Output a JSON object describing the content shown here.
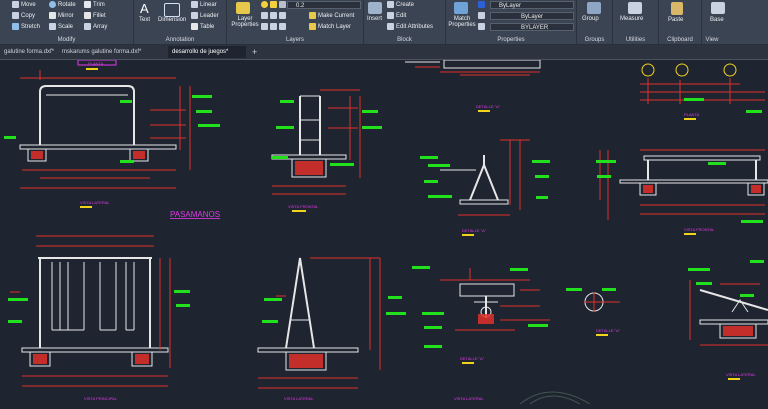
{
  "ribbon": {
    "modify": {
      "label": "Modify",
      "move": "Move",
      "rotate": "Rotate",
      "trim": "Trim",
      "copy": "Copy",
      "mirror": "Mirror",
      "fillet": "Fillet",
      "stretch": "Stretch",
      "scale": "Scale",
      "array": "Array"
    },
    "annotation": {
      "label": "Annotation",
      "text": "Text",
      "dimension": "Dimension",
      "linear": "Linear",
      "leader": "Leader",
      "table": "Table"
    },
    "layers": {
      "label": "Layers",
      "layer_properties": "Layer Properties",
      "current_layer": "0.2",
      "make_current": "Make Current",
      "match_layer": "Match Layer"
    },
    "block": {
      "label": "Block",
      "insert": "Insert",
      "create": "Create",
      "edit": "Edit",
      "edit_attributes": "Edit Attributes"
    },
    "properties": {
      "label": "Properties",
      "match_properties": "Match Properties",
      "color": "ByLayer",
      "linetype": "ByLayer",
      "lineweight": "BYLAYER"
    },
    "groups": {
      "label": "Groups",
      "group": "Group"
    },
    "utilities": {
      "label": "Utilities",
      "measure": "Measure"
    },
    "clipboard": {
      "label": "Clipboard",
      "paste": "Paste"
    },
    "view": {
      "label": "View",
      "base": "Base"
    }
  },
  "tabs": [
    {
      "label": "galutine forma.dxf*"
    },
    {
      "label": "mskarums galutine forma.dxf*"
    },
    {
      "label": "desarrollo de juegos*"
    }
  ],
  "drawing": {
    "title_pasamanos": "PASAMANOS",
    "labels": [
      "PLANTA",
      "DETALLE \"A\"",
      "PLANTA",
      "VISTA LATERAL",
      "VISTA FRONTAL",
      "DETALLE \"A\"",
      "VISTA FRONTAL",
      "VISTA PRINCIPAL",
      "VISTA LATERAL",
      "VISTA LATERAL",
      "DETALLE \"A\"",
      "DETALLE \"A\"",
      "VISTA LATERAL"
    ]
  },
  "colors": {
    "ribbon": "#3b4453",
    "canvas": "#1e2430",
    "green": "#22e01c",
    "red": "#e0302a",
    "white": "#e6e6e6",
    "magenta": "#e23ae8",
    "yellow": "#f2d21b"
  }
}
